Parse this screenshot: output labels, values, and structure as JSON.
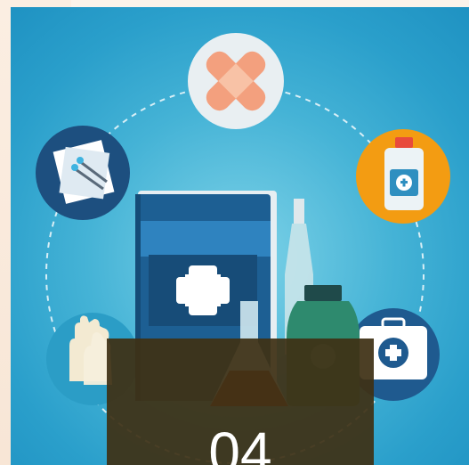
{
  "slide": {
    "number_label": "04"
  },
  "icons": {
    "center": "medical-book-icon",
    "top": "bandage-icon",
    "left": "gauze-pins-icon",
    "right": "medicine-bottle-icon",
    "bottom_left": "gloves-icon",
    "bottom_right": "first-aid-kit-icon"
  },
  "colors": {
    "background": "#2a9fcb",
    "overlay": "#3e3014",
    "book": "#1d5f93",
    "accent_orange": "#f39c12"
  }
}
